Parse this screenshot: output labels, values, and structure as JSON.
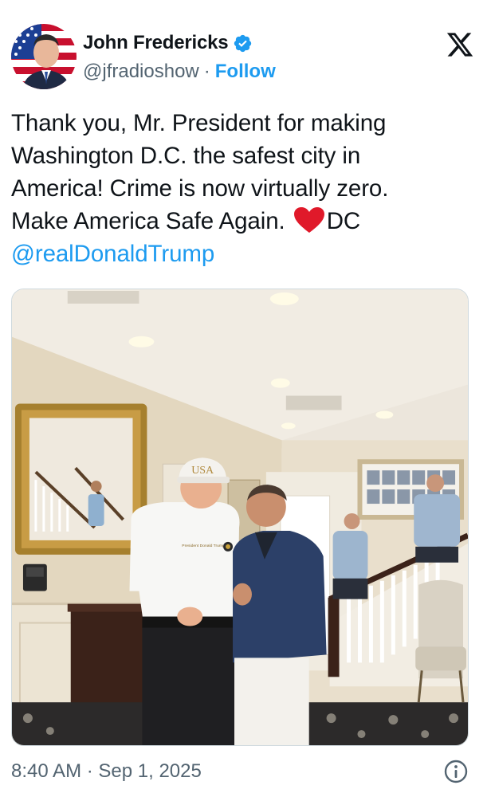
{
  "author": {
    "display_name": "John Fredericks",
    "handle": "@jfradioshow",
    "separator": "·",
    "follow_label": "Follow",
    "verified_icon": "verified-badge-icon",
    "colors": {
      "accent": "#1d9bf0",
      "text": "#0f1419",
      "muted": "#536471"
    }
  },
  "tweet": {
    "lines": [
      "Thank you, Mr. President for making",
      "Washington D.C. the safest city in",
      "America! Crime is now virtually zero.",
      "Make America Safe Again."
    ],
    "heart_suffix": "DC",
    "mention": "@realDonaldTrump"
  },
  "media": {
    "description_icon": "photo",
    "cap_text": "USA",
    "shirt_text": "President Donald Trump"
  },
  "footer": {
    "time": "8:40 AM",
    "separator": "·",
    "date": "Sep 1, 2025",
    "info_icon": "info-icon"
  }
}
